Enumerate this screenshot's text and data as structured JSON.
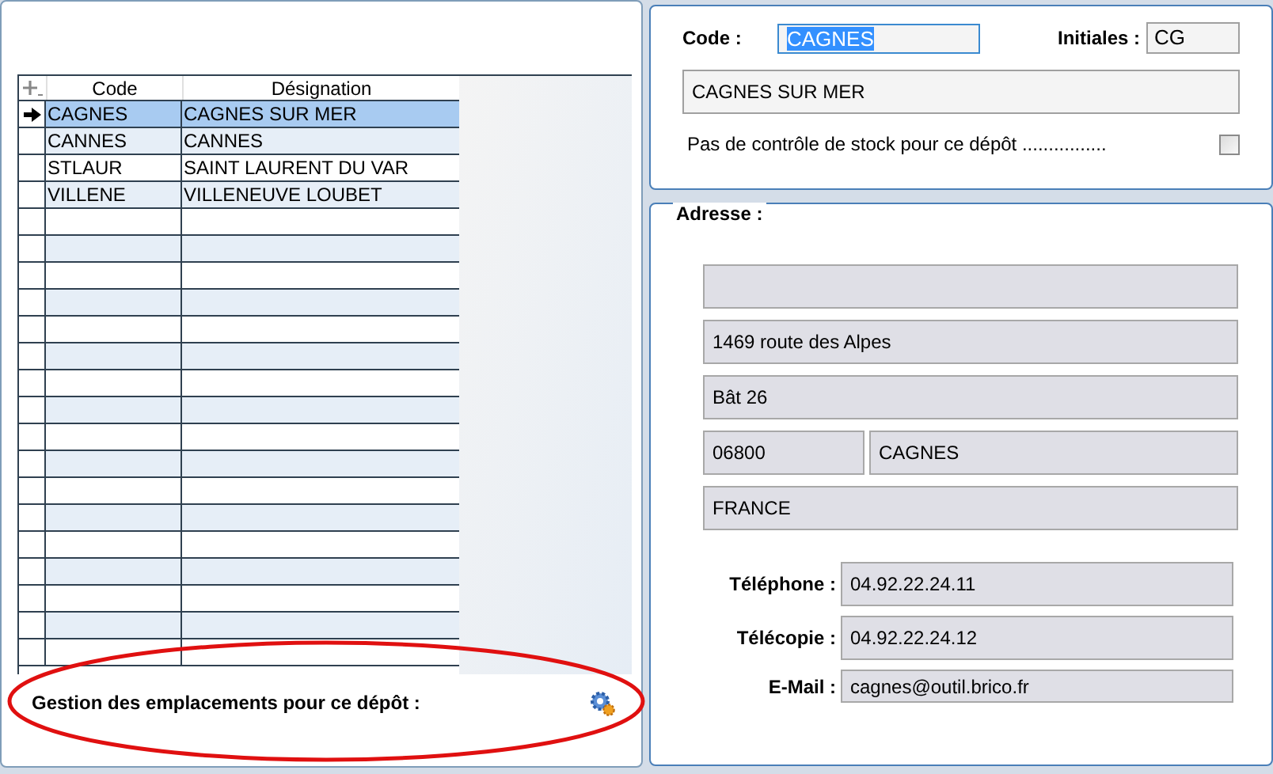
{
  "depots_grid": {
    "columns": [
      "Code",
      "Désignation"
    ],
    "rows": [
      {
        "code": "CAGNES",
        "designation": "CAGNES SUR MER",
        "selected": true
      },
      {
        "code": "CANNES",
        "designation": "CANNES",
        "selected": false
      },
      {
        "code": "STLAUR",
        "designation": "SAINT LAURENT DU VAR",
        "selected": false
      },
      {
        "code": "VILLENE",
        "designation": "VILLENEUVE LOUBET",
        "selected": false
      }
    ]
  },
  "locations": {
    "label": "Gestion des emplacements pour ce dépôt  :"
  },
  "code": {
    "label": "Code :",
    "value": "CAGNES"
  },
  "initials": {
    "label": "Initiales :",
    "value": "CG"
  },
  "name": {
    "value": "CAGNES SUR MER"
  },
  "no_stock_control": {
    "label": "Pas de contrôle de stock pour ce dépôt ................",
    "checked": false
  },
  "address": {
    "legend": "Adresse :",
    "line_2": "1469 route des Alpes",
    "line_3": "Bât 26",
    "postal_code": "06800",
    "city": "CAGNES",
    "country": "FRANCE"
  },
  "contacts": [
    {
      "label": "Téléphone :",
      "value": "04.92.22.24.11"
    },
    {
      "label": "Télécopie :",
      "value": "04.92.22.24.12"
    },
    {
      "label": "E-Mail :",
      "value": "cagnes@outil.brico.fr"
    }
  ]
}
